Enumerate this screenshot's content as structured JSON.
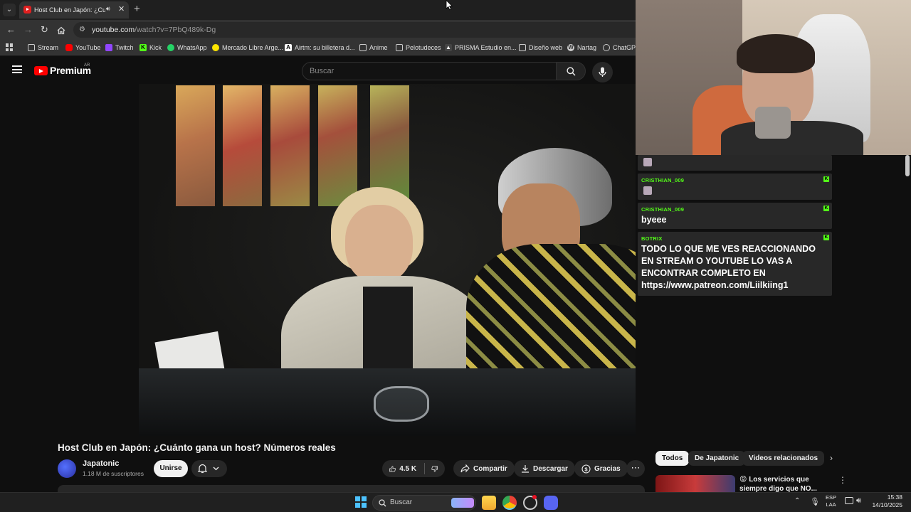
{
  "browser": {
    "tab": {
      "title": "Host Club en Japón: ¿Cuánto gana",
      "close_glyph": "✕"
    },
    "new_tab_glyph": "+",
    "url": {
      "host": "youtube.com",
      "path": "/watch?v=7PbQ489k-Dg"
    },
    "bookmarks": [
      {
        "label": "Stream",
        "icon": "folder-icon"
      },
      {
        "label": "YouTube",
        "icon": "youtube-icon"
      },
      {
        "label": "Twitch",
        "icon": "twitch-icon"
      },
      {
        "label": "Kick",
        "icon": "kick-icon"
      },
      {
        "label": "WhatsApp",
        "icon": "whatsapp-icon"
      },
      {
        "label": "Mercado Libre Arge...",
        "icon": "mercadolibre-icon"
      },
      {
        "label": "Airtm: su billetera d...",
        "icon": "airtm-icon"
      },
      {
        "label": "Anime",
        "icon": "folder-icon"
      },
      {
        "label": "Pelotudeces",
        "icon": "folder-icon"
      },
      {
        "label": "PRISMA Estudio en...",
        "icon": "prisma-icon"
      },
      {
        "label": "Diseño web",
        "icon": "folder-icon"
      },
      {
        "label": "Nartag",
        "icon": "wordpress-icon"
      },
      {
        "label": "ChatGPT",
        "icon": "chatgpt-icon"
      }
    ]
  },
  "masthead": {
    "logo_text": "Premium",
    "country": "AR",
    "search_placeholder": "Buscar"
  },
  "video": {
    "title": "Host Club en Japón: ¿Cuánto gana un host? Números reales",
    "channel": "Japatonic",
    "subscribers": "1.18 M de suscriptores",
    "join_label": "Unirse",
    "likes": "4.5 K",
    "share_label": "Compartir",
    "download_label": "Descargar",
    "thanks_label": "Gracias",
    "more_glyph": "⋯"
  },
  "sidebar": {
    "chips": [
      "Todos",
      "De Japatonic",
      "Videos relacionados"
    ],
    "next_glyph": "›",
    "recommendation_title": "😡 Los servicios que siempre digo que NO...",
    "menu_glyph": "⋮"
  },
  "chat": {
    "messages": [
      {
        "user": "CRISTHIAN_009",
        "text": ""
      },
      {
        "user": "CRISTHIAN_009",
        "text": "byeee"
      },
      {
        "user": "BOTRIX",
        "text": "TODO LO QUE ME VES REACCIONANDO EN STREAM O YOUTUBE LO VAS A ENCONTRAR COMPLETO EN",
        "link": "https://www.patreon.com/Liilkiing1"
      }
    ],
    "badge": "K"
  },
  "taskbar": {
    "search_label": "Buscar",
    "lang_top": "ESP",
    "lang_bottom": "LAA",
    "time": "15:38",
    "date": "14/10/2025"
  },
  "colors": {
    "kick_green": "#53fc18",
    "yt_red": "#ff0000",
    "background": "#0f0f0f"
  }
}
